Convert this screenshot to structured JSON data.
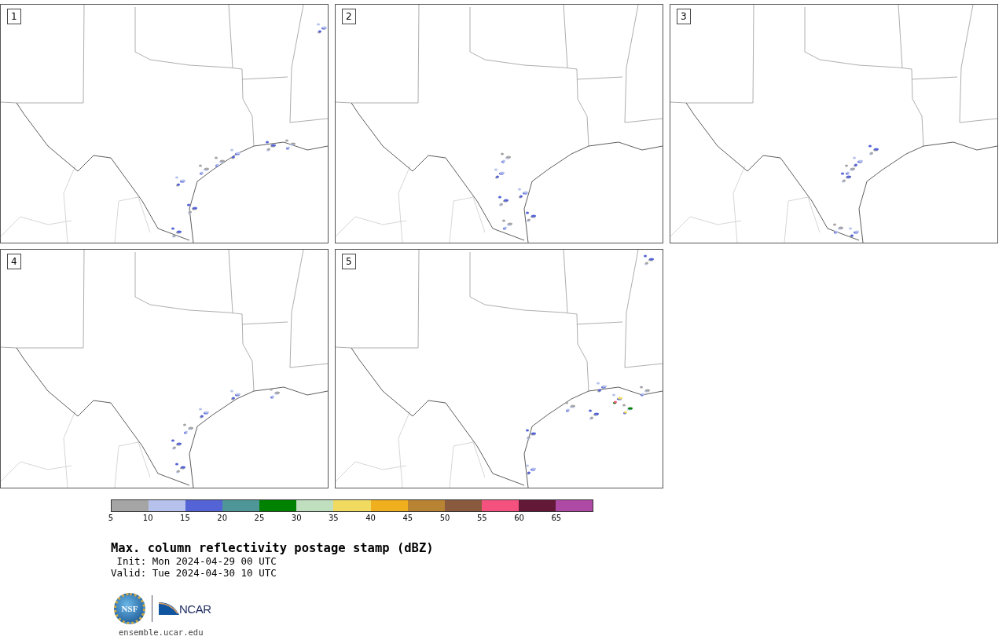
{
  "panels": [
    {
      "label": "1"
    },
    {
      "label": "2"
    },
    {
      "label": "3"
    },
    {
      "label": "4"
    },
    {
      "label": "5"
    }
  ],
  "colorbar": {
    "segments": [
      {
        "color": "#a5a5a5"
      },
      {
        "color": "#b6c2ec"
      },
      {
        "color": "#5463d6"
      },
      {
        "color": "#4f9698"
      },
      {
        "color": "#008200"
      },
      {
        "color": "#bfdfbf"
      },
      {
        "color": "#f0da60"
      },
      {
        "color": "#efaf1f"
      },
      {
        "color": "#b88332"
      },
      {
        "color": "#8a5a3f"
      },
      {
        "color": "#f5517f"
      },
      {
        "color": "#641838"
      },
      {
        "color": "#ae4aa6"
      }
    ],
    "ticks": [
      "5",
      "10",
      "15",
      "20",
      "25",
      "30",
      "35",
      "40",
      "45",
      "50",
      "55",
      "60",
      "65"
    ]
  },
  "title": "Max. column reflectivity postage stamp (dBZ)",
  "init": " Init: Mon 2024-04-29 00 UTC",
  "valid": "Valid: Tue 2024-04-30 10 UTC",
  "logo": {
    "seal_text": "NSF",
    "wordmark": "NCAR"
  },
  "url": "ensemble.ucar.edu"
}
